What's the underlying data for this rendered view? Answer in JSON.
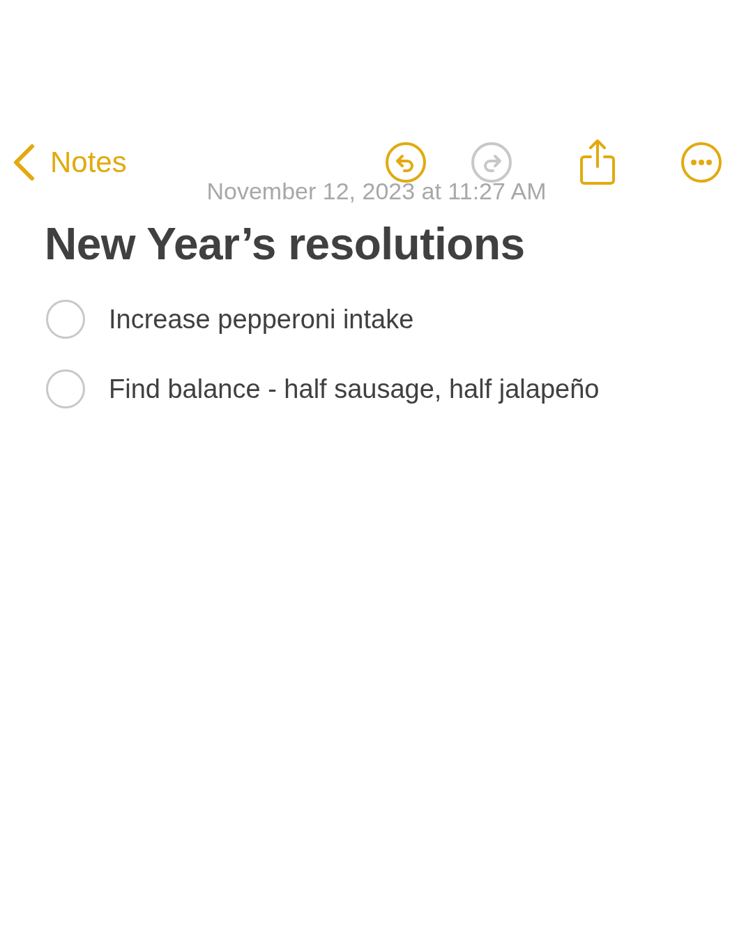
{
  "nav": {
    "back_label": "Notes",
    "buttons": [
      {
        "kind": "undo",
        "disabled": false
      },
      {
        "kind": "redo",
        "disabled": true
      },
      {
        "kind": "share",
        "disabled": false
      },
      {
        "kind": "more",
        "disabled": false
      }
    ]
  },
  "date": "November 12, 2023 at 11:27 AM",
  "title": "New Year’s resolutions",
  "checklist": [
    {
      "text": "Increase pepperoni intake",
      "checked": false
    },
    {
      "text": "Find balance - half sausage, half jalapeño",
      "checked": false
    }
  ]
}
